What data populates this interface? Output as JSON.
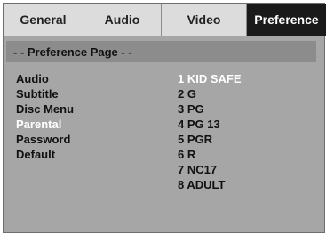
{
  "tabs": [
    {
      "label": "General"
    },
    {
      "label": "Audio"
    },
    {
      "label": "Video"
    },
    {
      "label": "Preference",
      "active": true
    }
  ],
  "page": {
    "title": "- -  Preference Page  - -"
  },
  "menu": {
    "items": [
      {
        "label": "Audio"
      },
      {
        "label": "Subtitle"
      },
      {
        "label": "Disc Menu"
      },
      {
        "label": "Parental",
        "selected": true
      },
      {
        "label": "Password"
      },
      {
        "label": "Default"
      }
    ]
  },
  "parental_options": {
    "items": [
      {
        "label": "1 KID SAFE",
        "selected": true
      },
      {
        "label": "2 G"
      },
      {
        "label": "3 PG"
      },
      {
        "label": "4 PG 13"
      },
      {
        "label": "5 PGR"
      },
      {
        "label": "6 R"
      },
      {
        "label": "7 NC17"
      },
      {
        "label": "8 ADULT"
      }
    ]
  }
}
